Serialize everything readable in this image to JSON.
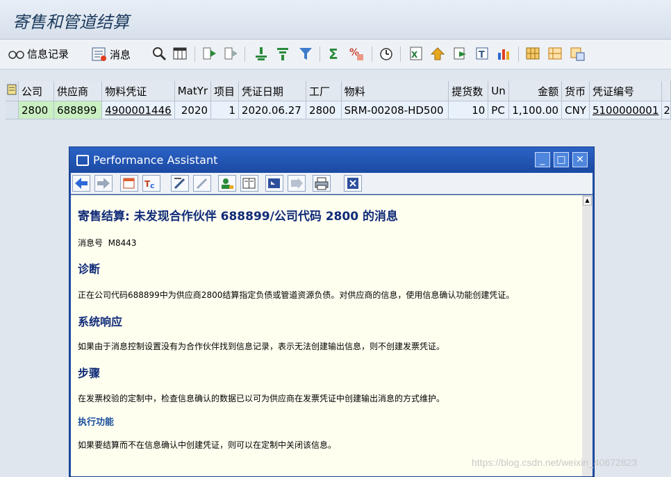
{
  "title": "寄售和管道结算",
  "toolbar": {
    "info_record_label": "信息记录",
    "messages_label": "消息"
  },
  "grid": {
    "headers": [
      "公司",
      "供应商",
      "物料凭证",
      "MatYr",
      "项目",
      "凭证日期",
      "工厂",
      "物料",
      "提货数",
      "Un",
      "金额",
      "货币",
      "凭证编号"
    ],
    "row": {
      "company": "2800",
      "vendor": "688899",
      "mat_doc": "4900001446",
      "mat_yr": "2020",
      "item": "1",
      "doc_date": "2020.06.27",
      "plant": "2800",
      "material": "SRM-00208-HD500",
      "qty": "10",
      "unit": "PC",
      "amount": "1,100.00",
      "currency": "CNY",
      "doc_no": "5100000001",
      "overflow": "2"
    }
  },
  "dialog": {
    "title": "Performance Assistant",
    "heading": "寄售结算: 未发现合作伙伴 688899/公司代码 2800 的消息",
    "message_no_label": "消息号",
    "message_no": "M8443",
    "diagnosis_title": "诊断",
    "diagnosis_text": "正在公司代码688899中为供应商2800结算指定负债或管道资源负债。对供应商的信息，使用信息确认功能创建凭证。",
    "system_response_title": "系统响应",
    "system_response_text": "如果由于消息控制设置没有为合作伙伴找到信息记录，表示无法创建输出信息，则不创建发票凭证。",
    "procedure_title": "步骤",
    "procedure_text": "在发票校验的定制中，检查信息确认的数据已以可为供应商在发票凭证中创建输出消息的方式维护。",
    "execute_function_title": "执行功能",
    "execute_function_text": "如果要结算而不在信息确认中创建凭证，则可以在定制中关闭该信息。"
  },
  "watermark": "https://blog.csdn.net/weixin_40672823",
  "colors": {
    "dialog_frame": "#1f4fa8",
    "help_background": "#fffff0",
    "heading_text": "#102b78",
    "vendor_cell": "#c9efc2"
  }
}
